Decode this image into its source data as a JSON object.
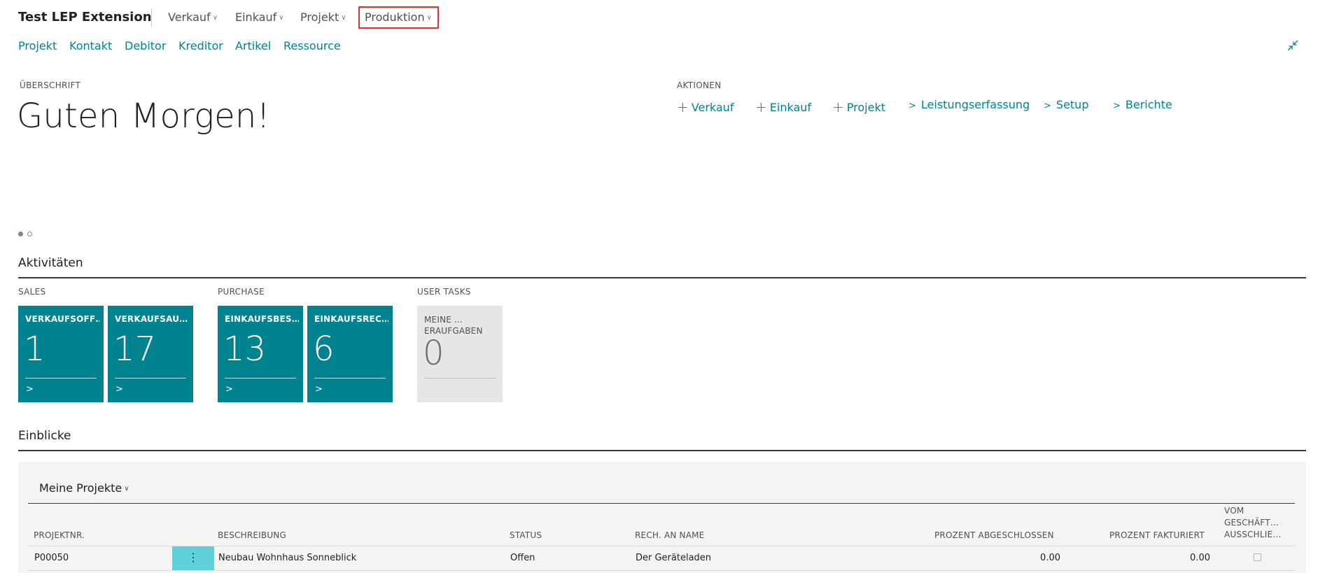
{
  "app": {
    "title": "Test LEP Extension"
  },
  "nav": {
    "items": [
      {
        "label": "Verkauf"
      },
      {
        "label": "Einkauf"
      },
      {
        "label": "Projekt"
      },
      {
        "label": "Produktion"
      }
    ],
    "highlighted": "Produktion",
    "chevron_icon": "chevron-down-icon"
  },
  "subnav": {
    "items": [
      {
        "label": "Projekt"
      },
      {
        "label": "Kontakt"
      },
      {
        "label": "Debitor"
      },
      {
        "label": "Kreditor"
      },
      {
        "label": "Artikel"
      },
      {
        "label": "Ressource"
      }
    ]
  },
  "headline": {
    "caption": "ÜBERSCHRIFT",
    "greeting": "Guten Morgen!"
  },
  "actions": {
    "caption": "AKTIONEN",
    "items": [
      {
        "label": "Verkauf",
        "icon": "plus-icon"
      },
      {
        "label": "Einkauf",
        "icon": "plus-icon"
      },
      {
        "label": "Projekt",
        "icon": "plus-icon"
      },
      {
        "label": "Leistungserfassung",
        "icon": "chevron-right-icon"
      },
      {
        "label": "Setup",
        "icon": "chevron-right-icon"
      },
      {
        "label": "Berichte",
        "icon": "chevron-right-icon"
      }
    ]
  },
  "pager": {
    "pages": 2,
    "active": 1
  },
  "activities": {
    "title": "Aktivitäten",
    "groups": [
      {
        "caption": "SALES",
        "tiles": [
          {
            "caption": "VERKAUFSOFF…",
            "value": "1"
          },
          {
            "caption": "VERKAUFSAU…",
            "value": "17"
          }
        ]
      },
      {
        "caption": "PURCHASE",
        "tiles": [
          {
            "caption": "EINKAUFSBES…",
            "value": "13"
          },
          {
            "caption": "EINKAUFSREC…",
            "value": "6"
          }
        ]
      },
      {
        "caption": "USER TASKS",
        "tiles": [
          {
            "caption": "MEINE …ERAUFGABEN",
            "value": "0"
          }
        ]
      }
    ]
  },
  "insights": {
    "title": "Einblicke",
    "list_title": "Meine Projekte",
    "columns": [
      "PROJEKTNR.",
      "BESCHREIBUNG",
      "STATUS",
      "RECH. AN NAME",
      "PROZENT ABGESCHLOSSEN",
      "PROZENT FAKTURIERT",
      [
        "VOM",
        "GESCHÄFT…",
        "AUSSCHLIE…"
      ]
    ],
    "rows": [
      {
        "projektnr": "P00050",
        "beschreibung": "Neubau Wohnhaus Sonneblick",
        "status": "Offen",
        "rech_an_name": "Der Geräteladen",
        "prozent_abgeschlossen": "0.00",
        "prozent_fakturiert": "0.00",
        "ausgeschlossen": false
      }
    ]
  },
  "colors": {
    "accent": "#00838f",
    "tile_bg": "#00838f",
    "tile_grey": "#e6e6e6",
    "highlight_border": "#e03131",
    "row_action_bg": "#5fd1d9"
  }
}
